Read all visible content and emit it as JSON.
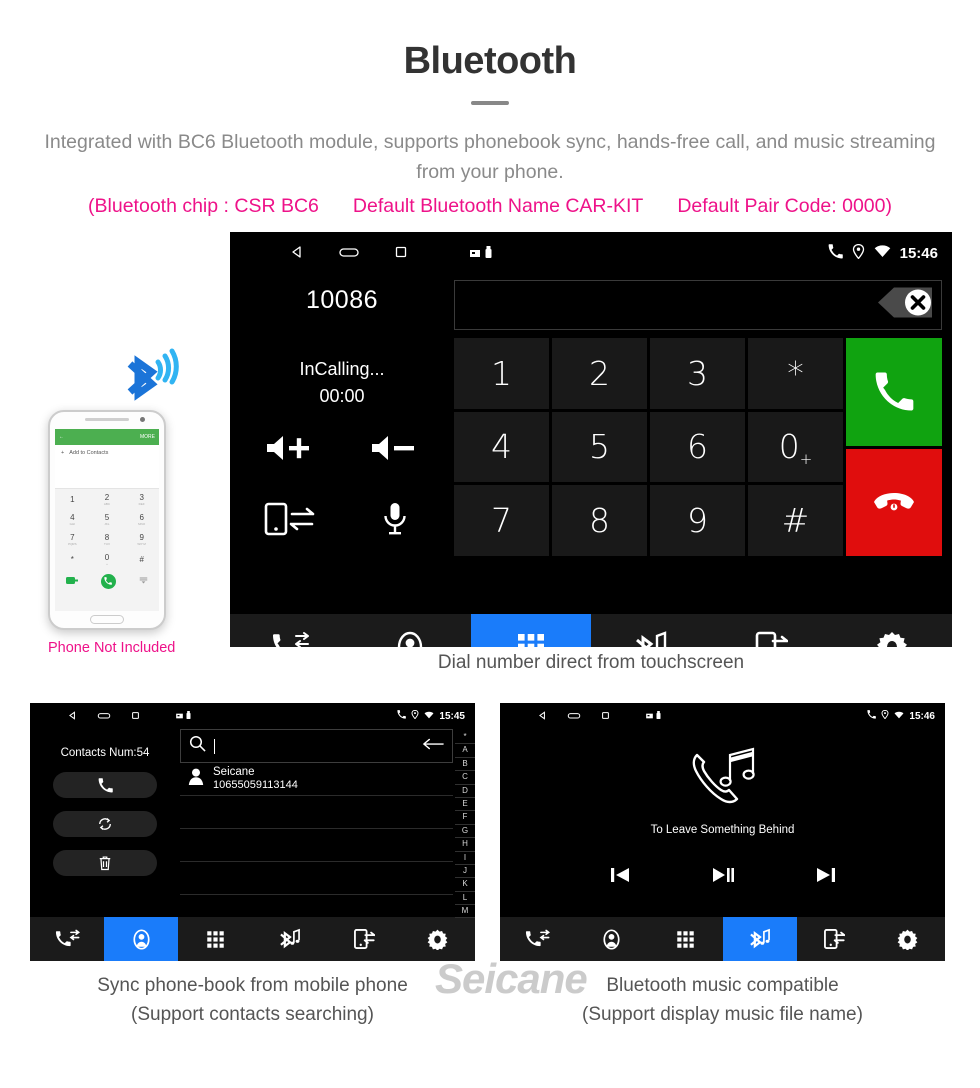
{
  "header": {
    "title": "Bluetooth",
    "subtitle": "Integrated with BC6 Bluetooth module, supports phonebook sync, hands-free call, and music streaming from your phone.",
    "specs": [
      "(Bluetooth chip : CSR BC6",
      "Default Bluetooth Name CAR-KIT",
      "Default Pair Code: 0000)"
    ],
    "accent_color": "#ee1289"
  },
  "dialer": {
    "statusbar": {
      "back_icon": "back-triangle-icon",
      "home_icon": "home-pill-icon",
      "recents_icon": "recents-square-icon",
      "sd_icon": "sdcard-icon",
      "usb_icon": "usb-icon",
      "phone_icon": "phone-icon",
      "location_icon": "location-pin-icon",
      "wifi_icon": "wifi-icon",
      "time": "15:46"
    },
    "number": "10086",
    "call_state": "InCalling...",
    "timer": "00:00",
    "side_icons": [
      {
        "name": "volume-up-icon",
        "label": "Volume up"
      },
      {
        "name": "volume-down-icon",
        "label": "Volume down"
      },
      {
        "name": "transfer-audio-icon",
        "label": "Transfer to phone"
      },
      {
        "name": "microphone-icon",
        "label": "Mute microphone"
      }
    ],
    "input_value": "",
    "backspace_icon": "backspace-delete-icon",
    "keys": [
      "1",
      "2",
      "3",
      "*",
      "4",
      "5",
      "6",
      "0",
      "7",
      "8",
      "9",
      "#"
    ],
    "zero_sub": "+",
    "call_button": {
      "icon": "call-handset-icon",
      "color": "#10a310"
    },
    "hangup_button": {
      "icon": "hangup-handset-icon",
      "color": "#e00d0d"
    },
    "active_tab": "dialpad"
  },
  "navbar": {
    "accent_color": "#1a7cfa",
    "items": [
      {
        "id": "calllog",
        "icon": "call-log-icon",
        "label": "Call log"
      },
      {
        "id": "contacts",
        "icon": "contacts-person-icon",
        "label": "Contacts"
      },
      {
        "id": "dialpad",
        "icon": "dialpad-grid-icon",
        "label": "Dial pad"
      },
      {
        "id": "btmusic",
        "icon": "bluetooth-music-icon",
        "label": "Bluetooth music"
      },
      {
        "id": "transfer",
        "icon": "phone-transfer-icon",
        "label": "Transfer"
      },
      {
        "id": "settings",
        "icon": "gear-icon",
        "label": "Settings"
      }
    ]
  },
  "phone_mockup": {
    "header_action": "MORE",
    "back_icon": "back-arrow-icon",
    "add_contact": "Add to Contacts",
    "plus_icon": "plus-icon",
    "keys": [
      {
        "d": "1",
        "s": ""
      },
      {
        "d": "2",
        "s": "ABC"
      },
      {
        "d": "3",
        "s": "DEF"
      },
      {
        "d": "4",
        "s": "GHI"
      },
      {
        "d": "5",
        "s": "JKL"
      },
      {
        "d": "6",
        "s": "MNO"
      },
      {
        "d": "7",
        "s": "PQRS"
      },
      {
        "d": "8",
        "s": "TUV"
      },
      {
        "d": "9",
        "s": "WXYZ"
      },
      {
        "d": "*",
        "s": ""
      },
      {
        "d": "0",
        "s": "+"
      },
      {
        "d": "#",
        "s": ""
      }
    ],
    "call_icon": "call-handset-icon",
    "sim_icon": "sim-card-icon",
    "keyboard_icon": "keyboard-icon",
    "bluetooth_icon": "bluetooth-signal-icon",
    "caption": "Phone Not Included"
  },
  "captions": {
    "main": "Dial number direct from touchscreen",
    "left_1": "Sync phone-book from mobile phone",
    "left_2": "(Support contacts searching)",
    "right_1": "Bluetooth music compatible",
    "right_2": "(Support display music file name)"
  },
  "contacts_screen": {
    "statusbar_time": "15:45",
    "contacts_num": "Contacts Num:54",
    "buttons": [
      {
        "icon": "call-handset-icon",
        "label": "Call"
      },
      {
        "icon": "sync-refresh-icon",
        "label": "Sync"
      },
      {
        "icon": "trash-delete-icon",
        "label": "Delete"
      }
    ],
    "search_icon": "search-icon",
    "search_value": "",
    "search_placeholder": "",
    "back_icon": "left-arrow-icon",
    "contact": {
      "name": "Seicane",
      "number": "10655059113144",
      "avatar": "person-avatar-icon"
    },
    "empty_rows": 3,
    "alpha_index": [
      "*",
      "A",
      "B",
      "C",
      "D",
      "E",
      "F",
      "G",
      "H",
      "I",
      "J",
      "K",
      "L",
      "M"
    ],
    "active_tab": "contacts"
  },
  "music_screen": {
    "statusbar_time": "15:46",
    "art_icon": "phone-music-note-icon",
    "track_title": "To Leave Something Behind",
    "controls": [
      {
        "id": "prev",
        "icon": "previous-track-icon"
      },
      {
        "id": "playpause",
        "icon": "play-pause-icon"
      },
      {
        "id": "next",
        "icon": "next-track-icon"
      }
    ],
    "active_tab": "btmusic"
  },
  "watermark": "Seicane"
}
